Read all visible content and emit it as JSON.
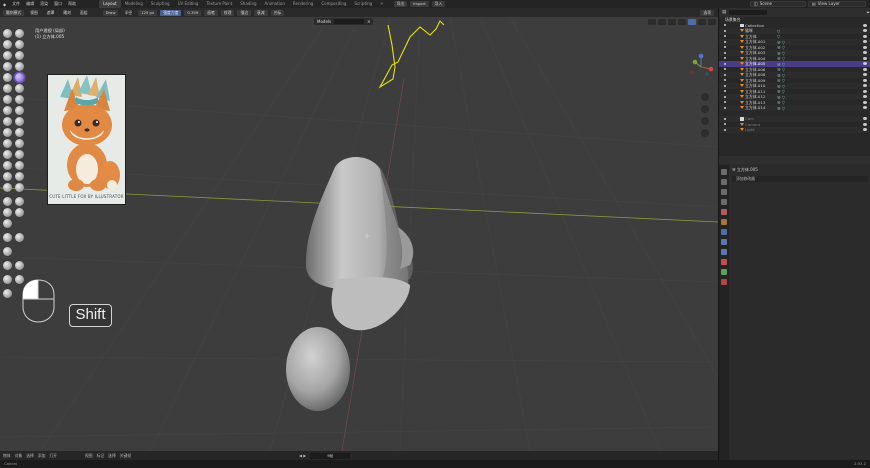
{
  "menu": [
    "文件",
    "编辑",
    "渲染",
    "窗口",
    "帮助"
  ],
  "workspaces": [
    "Layout",
    "Modeling",
    "Sculpting",
    "UV Editing",
    "Texture Paint",
    "Shading",
    "Animation",
    "Rendering",
    "Compositing",
    "Scripting"
  ],
  "active_workspace": "Layout",
  "top_buttons": [
    "导出",
    "Import",
    "导入"
  ],
  "scene": "Scene",
  "view_layer": "View Layer",
  "tool_header": {
    "mode": "雕刻模式",
    "tabs": [
      "视图",
      "遮罩",
      "雕刻",
      "面组"
    ],
    "brush": "Draw",
    "radius_label": "半径",
    "radius_value": "125 px",
    "strength_label": "强度力度",
    "strength_value": "0.359",
    "chips": [
      "画笔",
      "纹理",
      "描边",
      "衰减",
      "光标"
    ],
    "options": "选项"
  },
  "viewport": {
    "mode_text_line1": "用户透视 (局部)",
    "mode_text_line2": "(1) 立方体.005",
    "models_menu": "Models",
    "key_display": "Shift",
    "ref_caption": "CUTE LITTLE FOX BY ILLUSTRATOR"
  },
  "bottom_bar": [
    "物体",
    "对象",
    "选择",
    "添加",
    "打开",
    "视图",
    "标记",
    "选择",
    "关键帧"
  ],
  "bottom_field": "9帧",
  "status": {
    "left": "Cancel",
    "version": "2.93.2"
  },
  "outliner": {
    "title": "场景集合",
    "rows": [
      {
        "label": "Collection",
        "type": "collection"
      },
      {
        "label": "猫咪",
        "type": "mesh",
        "mod": "▽"
      },
      {
        "label": "立方体",
        "type": "mesh",
        "mod": "▽"
      },
      {
        "label": "立方体.001",
        "type": "mesh",
        "mod": "⚒ ▽"
      },
      {
        "label": "立方体.002",
        "type": "mesh",
        "mod": "⚒ ▽"
      },
      {
        "label": "立方体.003",
        "type": "mesh",
        "mod": "⚒ ▽"
      },
      {
        "label": "立方体.004",
        "type": "mesh",
        "mod": "⚒ ▽"
      },
      {
        "label": "立方体.005",
        "type": "mesh",
        "mod": "⚒ ▽",
        "selected": true
      },
      {
        "label": "立方体.006",
        "type": "mesh",
        "mod": "⚒ ▽"
      },
      {
        "label": "立方体.008",
        "type": "mesh",
        "mod": "⚒ ▽"
      },
      {
        "label": "立方体.009",
        "type": "mesh",
        "mod": "⚒ ▽"
      },
      {
        "label": "立方体.010",
        "type": "mesh",
        "mod": "⚒ ▽"
      },
      {
        "label": "立方体.011",
        "type": "mesh",
        "mod": "⚒ ▽"
      },
      {
        "label": "立方体.012",
        "type": "mesh",
        "mod": "⚒ ▽"
      },
      {
        "label": "立方体.013",
        "type": "mesh",
        "mod": "⚒ ▽"
      },
      {
        "label": "立方体.014",
        "type": "mesh",
        "mod": "⚒ ▽"
      },
      {
        "label": "",
        "type": "blank"
      },
      {
        "label": "Cam",
        "type": "collection",
        "dim": true
      },
      {
        "label": "Camera",
        "type": "camera",
        "dim": true
      },
      {
        "label": "Light",
        "type": "light",
        "dim": true
      }
    ]
  },
  "properties": {
    "object": "立方体.005",
    "modifier_label": "添加修改器"
  },
  "colors": {
    "accent": "#4b3c86",
    "annotation": "#e6e011",
    "xaxis": "#8c9a3e",
    "outliner_mesh": "#e88a2a"
  }
}
